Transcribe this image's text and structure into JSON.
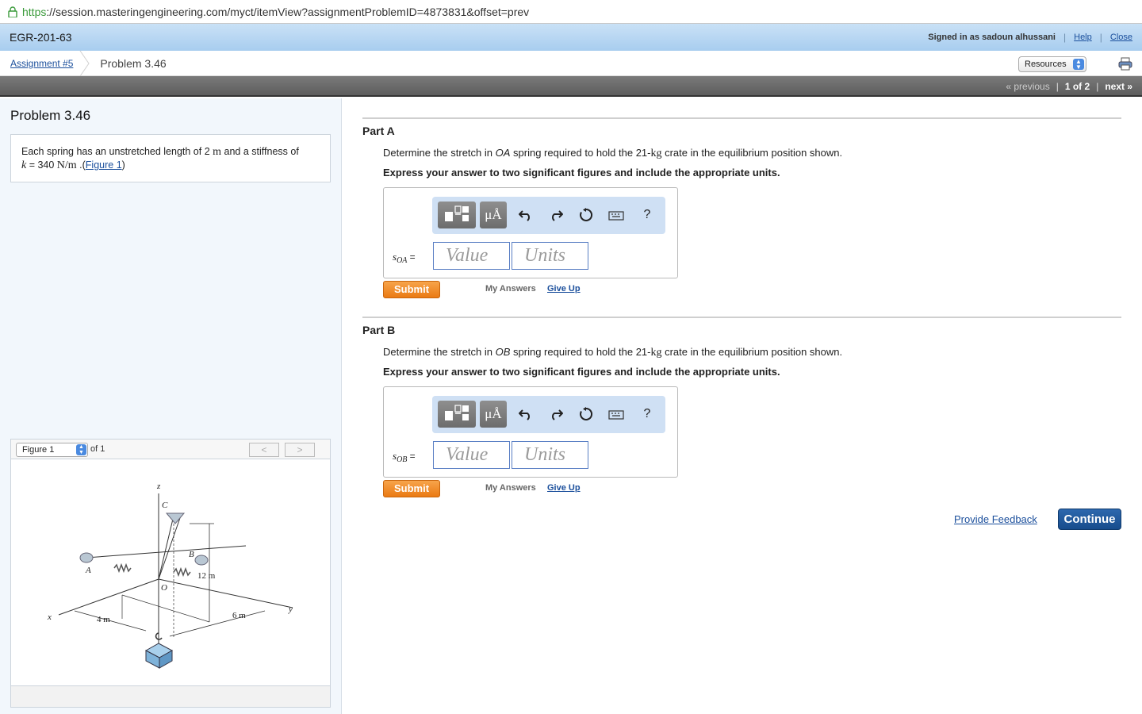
{
  "browser": {
    "url_scheme": "https",
    "url_rest": "://session.masteringengineering.com/myct/itemView?assignmentProblemID=4873831&offset=prev"
  },
  "header": {
    "course": "EGR-201-63",
    "signed_in": "Signed in as sadoun alhussani",
    "help": "Help",
    "close": "Close"
  },
  "breadcrumb": {
    "assignment": "Assignment #5",
    "problem": "Problem 3.46",
    "resources": "Resources"
  },
  "nav": {
    "previous": "« previous",
    "pager": "1 of 2",
    "next": "next »"
  },
  "problem": {
    "title": "Problem 3.46",
    "text_a": "Each spring has an unstretched length of 2",
    "unit_m": "m",
    "text_b": " and a stiffness of",
    "k_var": "k",
    "text_c": " = 340 ",
    "unit_nm": "N/m",
    "text_d": " .(",
    "figure_link": "Figure 1",
    "text_e": ")"
  },
  "figure": {
    "select": "Figure 1",
    "of": "of 1",
    "prev": "<",
    "next": ">",
    "labels": {
      "z": "z",
      "x": "x",
      "y": "y",
      "c": "C",
      "b": "B",
      "a": "A",
      "o": "O",
      "dim_12": "12 m",
      "dim_4": "4 m",
      "dim_6": "6 m"
    }
  },
  "partA": {
    "title": "Part A",
    "q1": "Determine the stretch in ",
    "q_spring": "OA",
    "q2": " spring required to hold the 21-",
    "q_unit": "kg",
    "q3": " crate in the equilibrium position shown.",
    "instr": "Express your answer to two significant figures and include the appropriate units.",
    "var": "s",
    "var_sub": "OA",
    "value_placeholder": "Value",
    "units_placeholder": "Units",
    "submit": "Submit",
    "my_answers": "My Answers",
    "give_up": "Give Up"
  },
  "partB": {
    "title": "Part B",
    "q1": "Determine the stretch in ",
    "q_spring": "OB",
    "q2": " spring required to hold the 21-",
    "q_unit": "kg",
    "q3": " crate in the equilibrium position shown.",
    "instr": "Express your answer to two significant figures and include the appropriate units.",
    "var": "s",
    "var_sub": "OB",
    "value_placeholder": "Value",
    "units_placeholder": "Units",
    "submit": "Submit",
    "my_answers": "My Answers",
    "give_up": "Give Up"
  },
  "toolbar": {
    "templates_icon": "templates-icon",
    "mu_label": "μÅ",
    "undo_icon": "undo-icon",
    "redo_icon": "redo-icon",
    "reset_icon": "reset-icon",
    "keyboard_icon": "keyboard-icon",
    "help": "?"
  },
  "footer": {
    "feedback": "Provide Feedback",
    "continue": "Continue"
  },
  "colors": {
    "link": "#1b4f9c",
    "submit": "#ea7a13",
    "continue": "#174c8c",
    "header_blue": "#a8cdef"
  }
}
